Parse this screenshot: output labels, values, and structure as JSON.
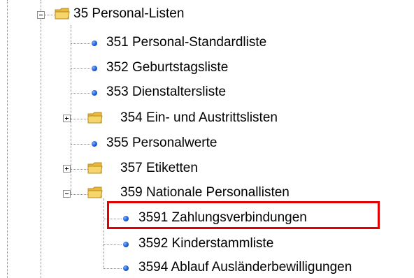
{
  "tree": {
    "nodes": [
      {
        "id": "35",
        "label": "35 Personal-Listen",
        "type": "folder",
        "state": "expanded"
      },
      {
        "id": "351",
        "label": "351 Personal-Standardliste",
        "type": "item"
      },
      {
        "id": "352",
        "label": "352 Geburtstagsliste",
        "type": "item"
      },
      {
        "id": "353",
        "label": "353 Dienstaltersliste",
        "type": "item"
      },
      {
        "id": "354",
        "label": "354 Ein- und Austrittslisten",
        "type": "folder",
        "state": "collapsed"
      },
      {
        "id": "355",
        "label": "355 Personalwerte",
        "type": "item"
      },
      {
        "id": "357",
        "label": "357 Etiketten",
        "type": "folder",
        "state": "collapsed"
      },
      {
        "id": "359",
        "label": "359 Nationale Personallisten",
        "type": "folder",
        "state": "expanded"
      },
      {
        "id": "3591",
        "label": "3591 Zahlungsverbindungen",
        "type": "item",
        "highlighted": true
      },
      {
        "id": "3592",
        "label": "3592 Kinderstammliste",
        "type": "item"
      },
      {
        "id": "3594",
        "label": "3594 Ablauf Ausländerbewilligungen",
        "type": "item"
      }
    ]
  },
  "colors": {
    "highlight_border": "#e00000",
    "bullet": "#1a5cd6",
    "folder": "#f2c94c",
    "tree_lines": "#8c8c8c"
  },
  "icons": {
    "folder": "folder-icon",
    "item": "list-item-bullet-icon",
    "expanded": "collapse-minus-icon",
    "collapsed": "expand-plus-icon"
  }
}
